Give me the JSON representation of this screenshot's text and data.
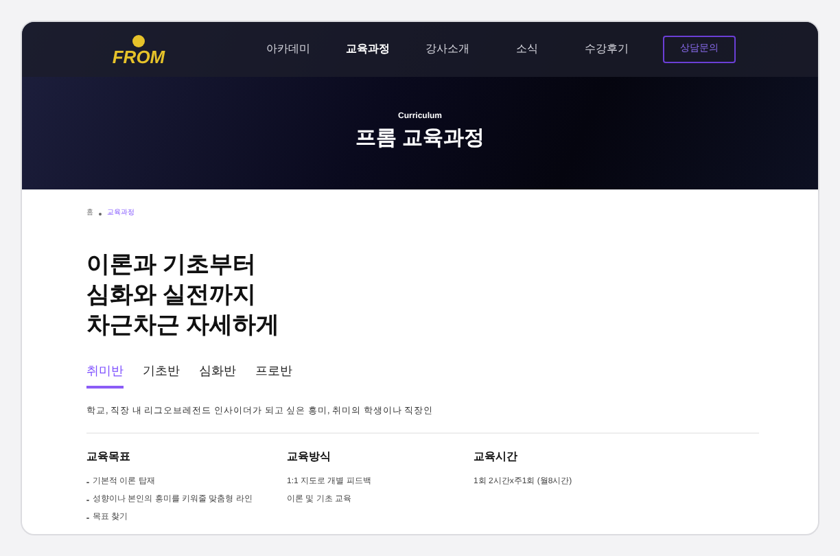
{
  "header": {
    "logo": "FROM",
    "nav": [
      {
        "label": "아카데미",
        "selected": false
      },
      {
        "label": "교육과정",
        "selected": true
      },
      {
        "label": "강사소개",
        "selected": false
      },
      {
        "label": "소식",
        "selected": false
      },
      {
        "label": "수강후기",
        "selected": false
      }
    ],
    "cta": "상담문의"
  },
  "hero": {
    "eyebrow": "Curriculum",
    "title": "프롬 교육과정"
  },
  "breadcrumb": [
    "홈",
    "교육과정"
  ],
  "headline": [
    "이론과 기초부터",
    "심화와 실전까지",
    "차근차근 자세하게"
  ],
  "tabs": [
    {
      "label": "취미반",
      "selected": true
    },
    {
      "label": "기초반",
      "selected": false
    },
    {
      "label": "심화반",
      "selected": false
    },
    {
      "label": "프로반",
      "selected": false
    }
  ],
  "description": "학교, 직장 내 리그오브레전드 인사이더가 되고 싶은 흥미, 취미의 학생이나 직장인",
  "columns": [
    {
      "title": "교육목표",
      "bulleted": true,
      "items": [
        "기본적 이론 탑재",
        "성향이나 본인의 흥미를 키워줄 맞춤형 라인",
        "목표 찾기"
      ]
    },
    {
      "title": "교육방식",
      "bulleted": false,
      "items": [
        "1:1 지도로 개별 피드백",
        "이론 및 기초 교육"
      ]
    },
    {
      "title": "교육시간",
      "bulleted": false,
      "items": [
        "1회 2시간x주1회 (월8시간)"
      ]
    }
  ]
}
